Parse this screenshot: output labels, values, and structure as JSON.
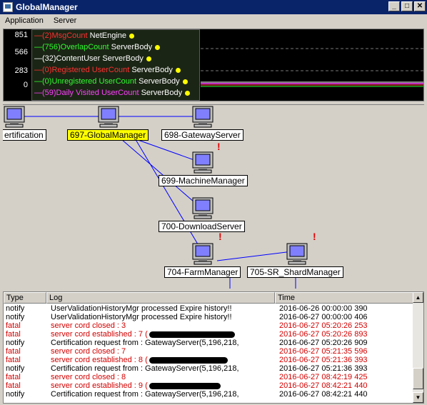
{
  "window": {
    "title": "GlobalManager",
    "min": "_",
    "max": "□",
    "close": "✕"
  },
  "menu": [
    "Application",
    "Server"
  ],
  "monitor": {
    "y_ticks": [
      "851",
      "566",
      "283",
      "0"
    ],
    "legend": [
      {
        "text": "—(2)MsgCount",
        "suffix": "NetEngine",
        "color": "#ff3030"
      },
      {
        "text": "—(756)OverlapCount",
        "suffix": "ServerBody",
        "color": "#30ff30"
      },
      {
        "text": "—(32)ContentUser",
        "suffix": "ServerBody",
        "color": "#ffffff"
      },
      {
        "text": "—(0)Registered UserCount",
        "suffix": "ServerBody",
        "color": "#ff3030"
      },
      {
        "text": "—(0)Unregistered UserCount",
        "suffix": "ServerBody",
        "color": "#30ff30"
      },
      {
        "text": "—(59)Daily Visited UserCount",
        "suffix": "ServerBody",
        "color": "#ff40ff"
      }
    ]
  },
  "diagram": {
    "nodes": [
      {
        "label": "ertification",
        "selected": false,
        "alert": false
      },
      {
        "label": "697-GlobalManager",
        "selected": true,
        "alert": false
      },
      {
        "label": "698-GatewayServer",
        "selected": false,
        "alert": false
      },
      {
        "label": "699-MachineManager",
        "selected": false,
        "alert": true
      },
      {
        "label": "700-DownloadServer",
        "selected": false,
        "alert": false
      },
      {
        "label": "704-FarmManager",
        "selected": false,
        "alert": true
      },
      {
        "label": "705-SR_ShardManager",
        "selected": false,
        "alert": true
      }
    ]
  },
  "log": {
    "columns": [
      "Type",
      "Log",
      "Time"
    ],
    "rows": [
      {
        "type": "notify",
        "log": "UserValidationHistoryMgr processed Expire history!!",
        "time": "2016-06-26 00:00:00 390",
        "redact": 0
      },
      {
        "type": "notify",
        "log": "UserValidationHistoryMgr processed Expire history!!",
        "time": "2016-06-27 00:00:00 406",
        "redact": 0
      },
      {
        "type": "fatal",
        "log": "server cord closed : 3",
        "time": "2016-06-27 05:20:26 253",
        "redact": 0
      },
      {
        "type": "fatal",
        "log": "server cord established : 7 (",
        "time": "2016-06-27 05:20:26 893",
        "redact": 120
      },
      {
        "type": "notify",
        "log": "Certification request from : GatewayServer(5,196,218,",
        "time": "2016-06-27 05:20:26 909",
        "redact": 0
      },
      {
        "type": "fatal",
        "log": "server cord closed : 7",
        "time": "2016-06-27 05:21:35 596",
        "redact": 0
      },
      {
        "type": "fatal",
        "log": "server cord established : 8 (",
        "time": "2016-06-27 05:21:36 393",
        "redact": 110
      },
      {
        "type": "notify",
        "log": "Certification request from : GatewayServer(5,196,218,",
        "time": "2016-06-27 05:21:36 393",
        "redact": 0
      },
      {
        "type": "fatal",
        "log": "server cord closed : 8",
        "time": "2016-06-27 08:42:19 425",
        "redact": 0
      },
      {
        "type": "fatal",
        "log": "server cord established : 9 (",
        "time": "2016-06-27 08:42:21 440",
        "redact": 100
      },
      {
        "type": "notify",
        "log": "Certification request from : GatewayServer(5,196,218,",
        "time": "2016-06-27 08:42:21 440",
        "redact": 0
      }
    ]
  },
  "colors": {
    "title_bg": "#0a246a",
    "selected_label": "#ffff00",
    "fatal": "#d40000",
    "link": "#0000ff"
  }
}
